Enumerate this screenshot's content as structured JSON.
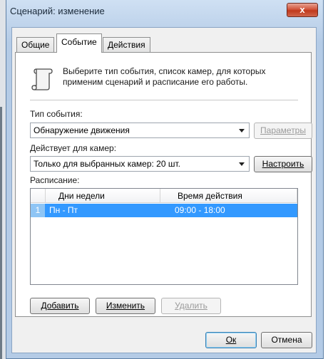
{
  "window": {
    "title": "Сценарий: изменение",
    "close_label": "x"
  },
  "tabs": [
    {
      "label": "Общие",
      "active": false
    },
    {
      "label": "Событие",
      "active": true
    },
    {
      "label": "Действия",
      "active": false
    }
  ],
  "info": {
    "icon": "scroll-icon",
    "text": "Выберите тип события, список камер, для которых применим сценарий и расписание его работы."
  },
  "event_type": {
    "label": "Тип события:",
    "value": "Обнаружение движения",
    "params_button": "Параметры"
  },
  "cameras": {
    "label": "Действует для камер:",
    "value": "Только для выбранных камер: 20 шт.",
    "configure_button": "Настроить"
  },
  "schedule": {
    "label": "Расписание:",
    "columns": [
      "Дни недели",
      "Время действия"
    ],
    "rows": [
      {
        "num": "1",
        "days": "Пн - Пт",
        "time": "09:00 - 18:00",
        "selected": true
      }
    ]
  },
  "schedule_buttons": {
    "add": "Добавить",
    "edit": "Изменить",
    "delete": "Удалить"
  },
  "dialog_buttons": {
    "ok": "Ок",
    "cancel": "Отмена"
  },
  "colors": {
    "selection": "#3399ff",
    "titlebar": "#b4cbe6",
    "close": "#c0391c"
  }
}
